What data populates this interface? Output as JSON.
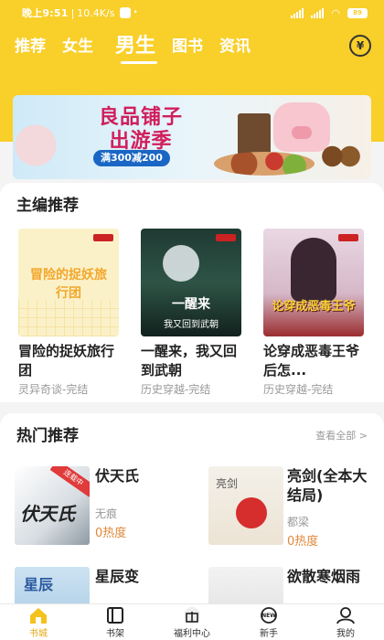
{
  "status_bar": {
    "time": "晚上9:51",
    "speed": "10.4K/s",
    "battery": "89"
  },
  "tabs": [
    {
      "label": "推荐"
    },
    {
      "label": "女生"
    },
    {
      "label": "男生"
    },
    {
      "label": "图书"
    },
    {
      "label": "资讯"
    }
  ],
  "active_tab": "男生",
  "coin_icon": "¥",
  "banner": {
    "title": "良品铺子\n出游季",
    "promo": "满300减200"
  },
  "editor_picks": {
    "title": "主编推荐",
    "books": [
      {
        "title": "冒险的捉妖旅行团",
        "category": "灵异奇谈-完结",
        "cover_text": "冒险的捉妖旅行团"
      },
      {
        "title": "一醒来，我又回到武朝",
        "category": "历史穿越-完结",
        "cover_text": "一醒来",
        "cover_sub": "我又回到武朝"
      },
      {
        "title": "论穿成恶毒王爷后怎...",
        "category": "历史穿越-完结",
        "cover_text": "论穿成恶毒王爷"
      }
    ]
  },
  "hot_picks": {
    "title": "热门推荐",
    "view_all": "查看全部 >",
    "books": [
      {
        "title": "伏天氏",
        "author": "无痕",
        "heat": "0热度",
        "cover_text": "伏天氏",
        "ribbon": "连载中"
      },
      {
        "title": "亮剑(全本大结局)",
        "author": "都梁",
        "heat": "0热度",
        "cover_text": "亮剑"
      },
      {
        "title": "星辰变",
        "author": "",
        "heat": "",
        "cover_text": "星辰"
      },
      {
        "title": "欲散寒烟雨",
        "author": "",
        "heat": "",
        "cover_text": ""
      }
    ]
  },
  "bottom_nav": [
    {
      "label": "书城",
      "icon": "home-icon",
      "active": true
    },
    {
      "label": "书架",
      "icon": "bookshelf-icon",
      "active": false
    },
    {
      "label": "福利中心",
      "icon": "gift-icon",
      "active": false
    },
    {
      "label": "新手",
      "icon": "new-user-icon",
      "active": false
    },
    {
      "label": "我的",
      "icon": "profile-icon",
      "active": false
    }
  ],
  "colors": {
    "brand_yellow": "#f9cf2a",
    "active_nav": "#e7a812",
    "heat_orange": "#e0883a"
  }
}
